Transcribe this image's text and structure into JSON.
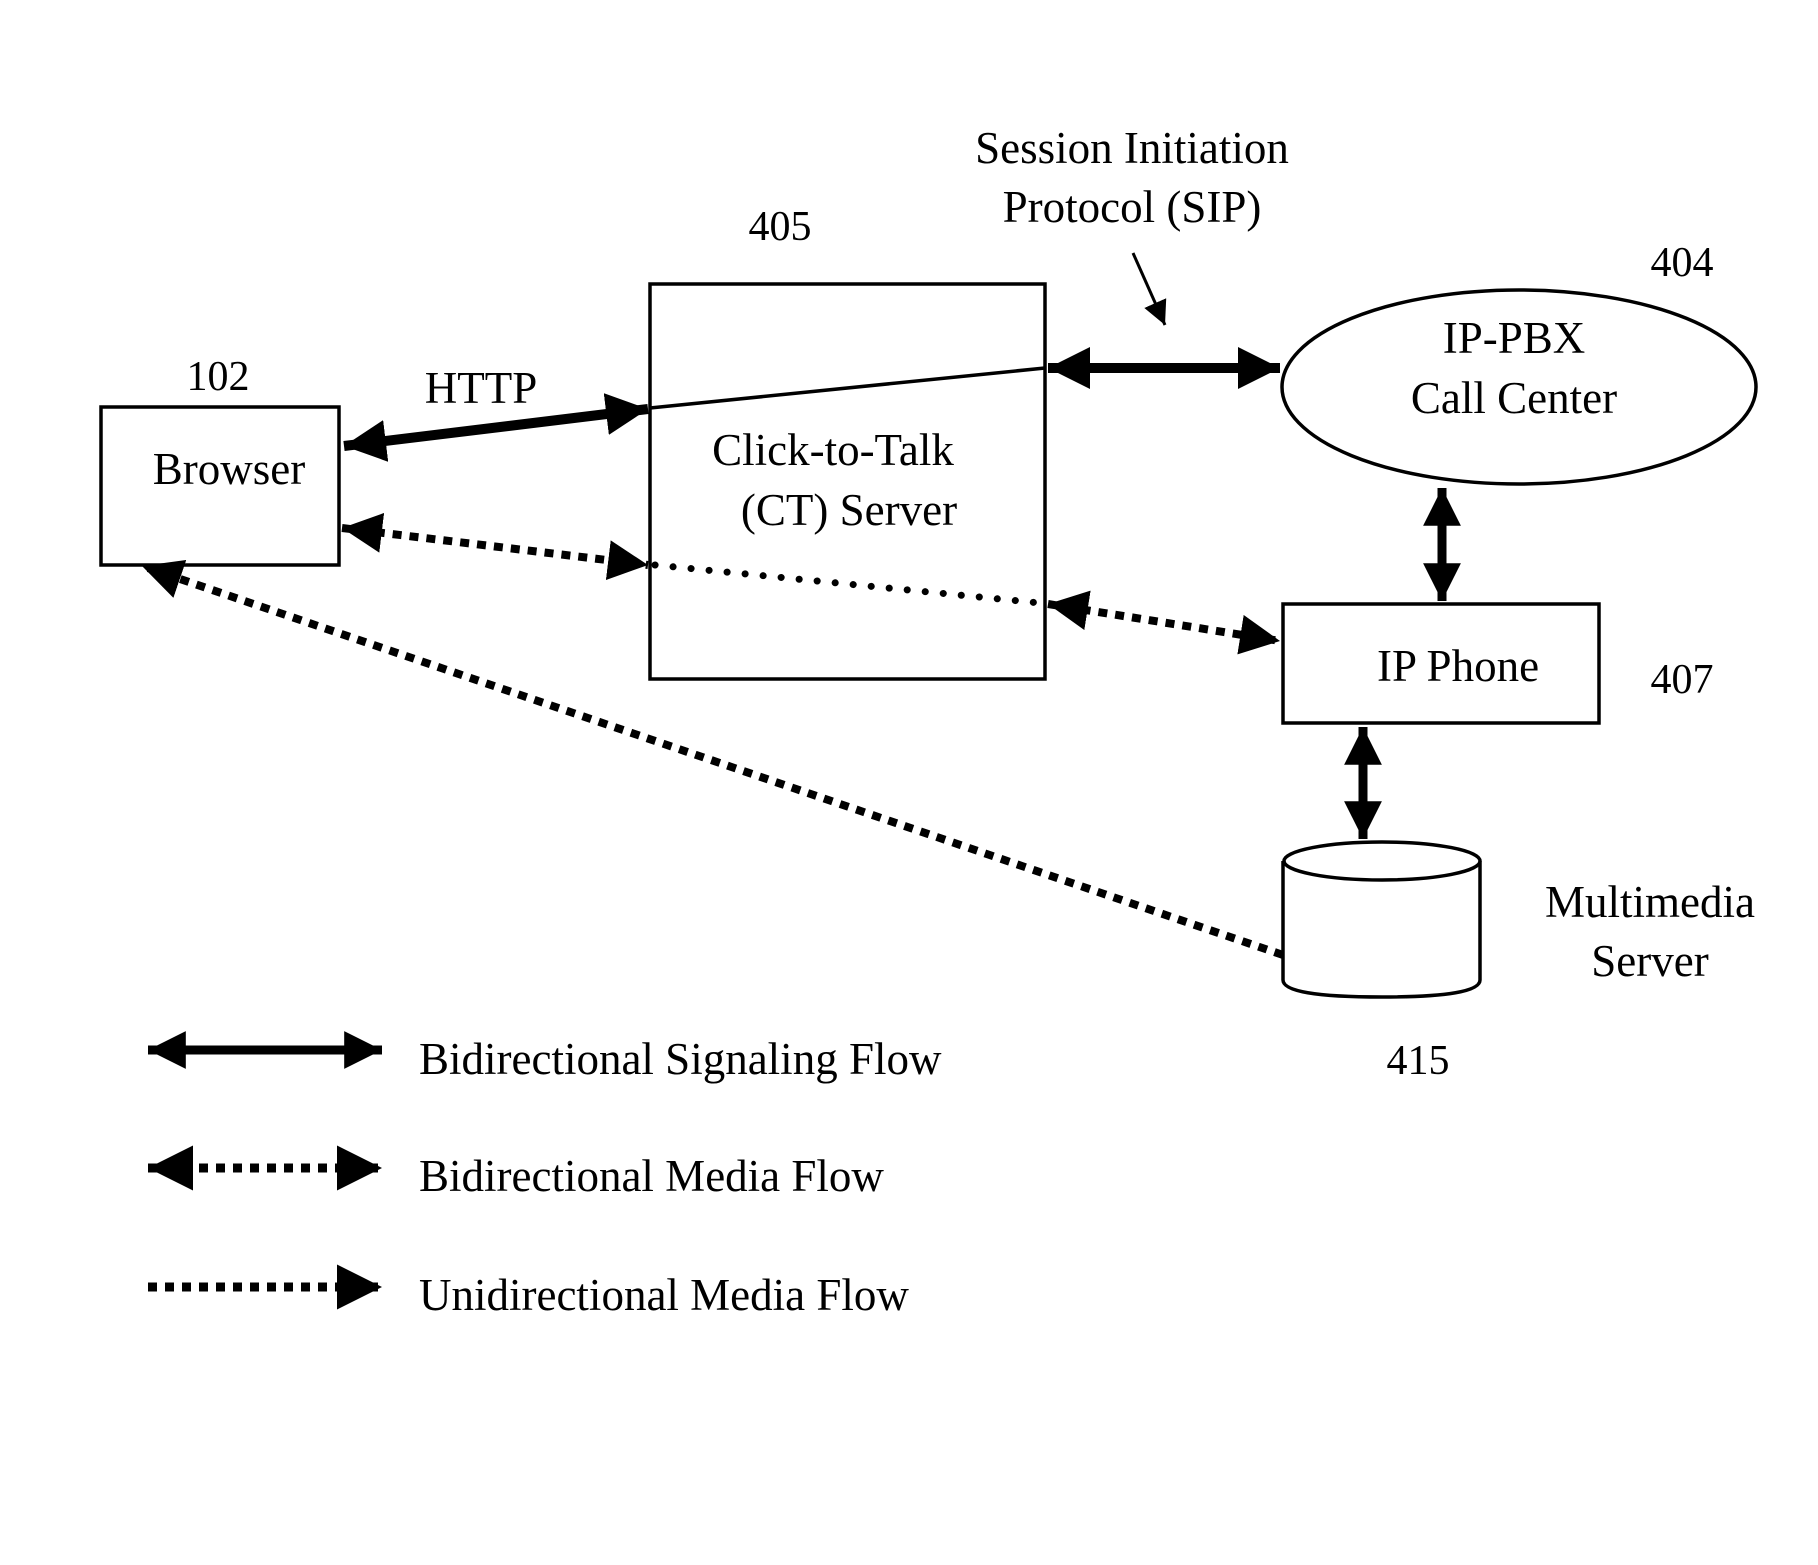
{
  "diagram": {
    "nodes": {
      "browser": {
        "ref": "102",
        "label": "Browser"
      },
      "ct_server": {
        "ref": "405",
        "label_lines": [
          "Click-to-Talk",
          "(CT) Server"
        ]
      },
      "ip_pbx": {
        "ref": "404",
        "label_lines": [
          "IP-PBX",
          "Call Center"
        ]
      },
      "ip_phone": {
        "ref": "407",
        "label": "IP Phone"
      },
      "multimedia_server": {
        "ref": "415",
        "label_lines": [
          "Multimedia",
          "Server"
        ]
      }
    },
    "edge_labels": {
      "http": "HTTP",
      "sip_lines": [
        "Session Initiation",
        "Protocol (SIP)"
      ]
    },
    "edges": [
      {
        "from": "browser",
        "to": "ct_server",
        "type": "bidirectional-signaling",
        "label": "HTTP"
      },
      {
        "from": "ct_server",
        "to": "ip_pbx",
        "type": "bidirectional-signaling",
        "label": "SIP"
      },
      {
        "from": "ip_pbx",
        "to": "ip_phone",
        "type": "bidirectional-signaling"
      },
      {
        "from": "ip_phone",
        "to": "multimedia_server",
        "type": "bidirectional-signaling"
      },
      {
        "from": "browser",
        "to": "ct_server",
        "type": "bidirectional-media"
      },
      {
        "from": "ct_server",
        "to": "ip_phone",
        "type": "bidirectional-media"
      },
      {
        "from": "multimedia_server",
        "to": "browser",
        "type": "unidirectional-media"
      }
    ],
    "legend": [
      {
        "type": "bidirectional-signaling",
        "label": "Bidirectional Signaling Flow"
      },
      {
        "type": "bidirectional-media",
        "label": "Bidirectional Media Flow"
      },
      {
        "type": "unidirectional-media",
        "label": "Unidirectional Media Flow"
      }
    ],
    "colors": {
      "ink": "#000000",
      "background": "#ffffff"
    }
  }
}
